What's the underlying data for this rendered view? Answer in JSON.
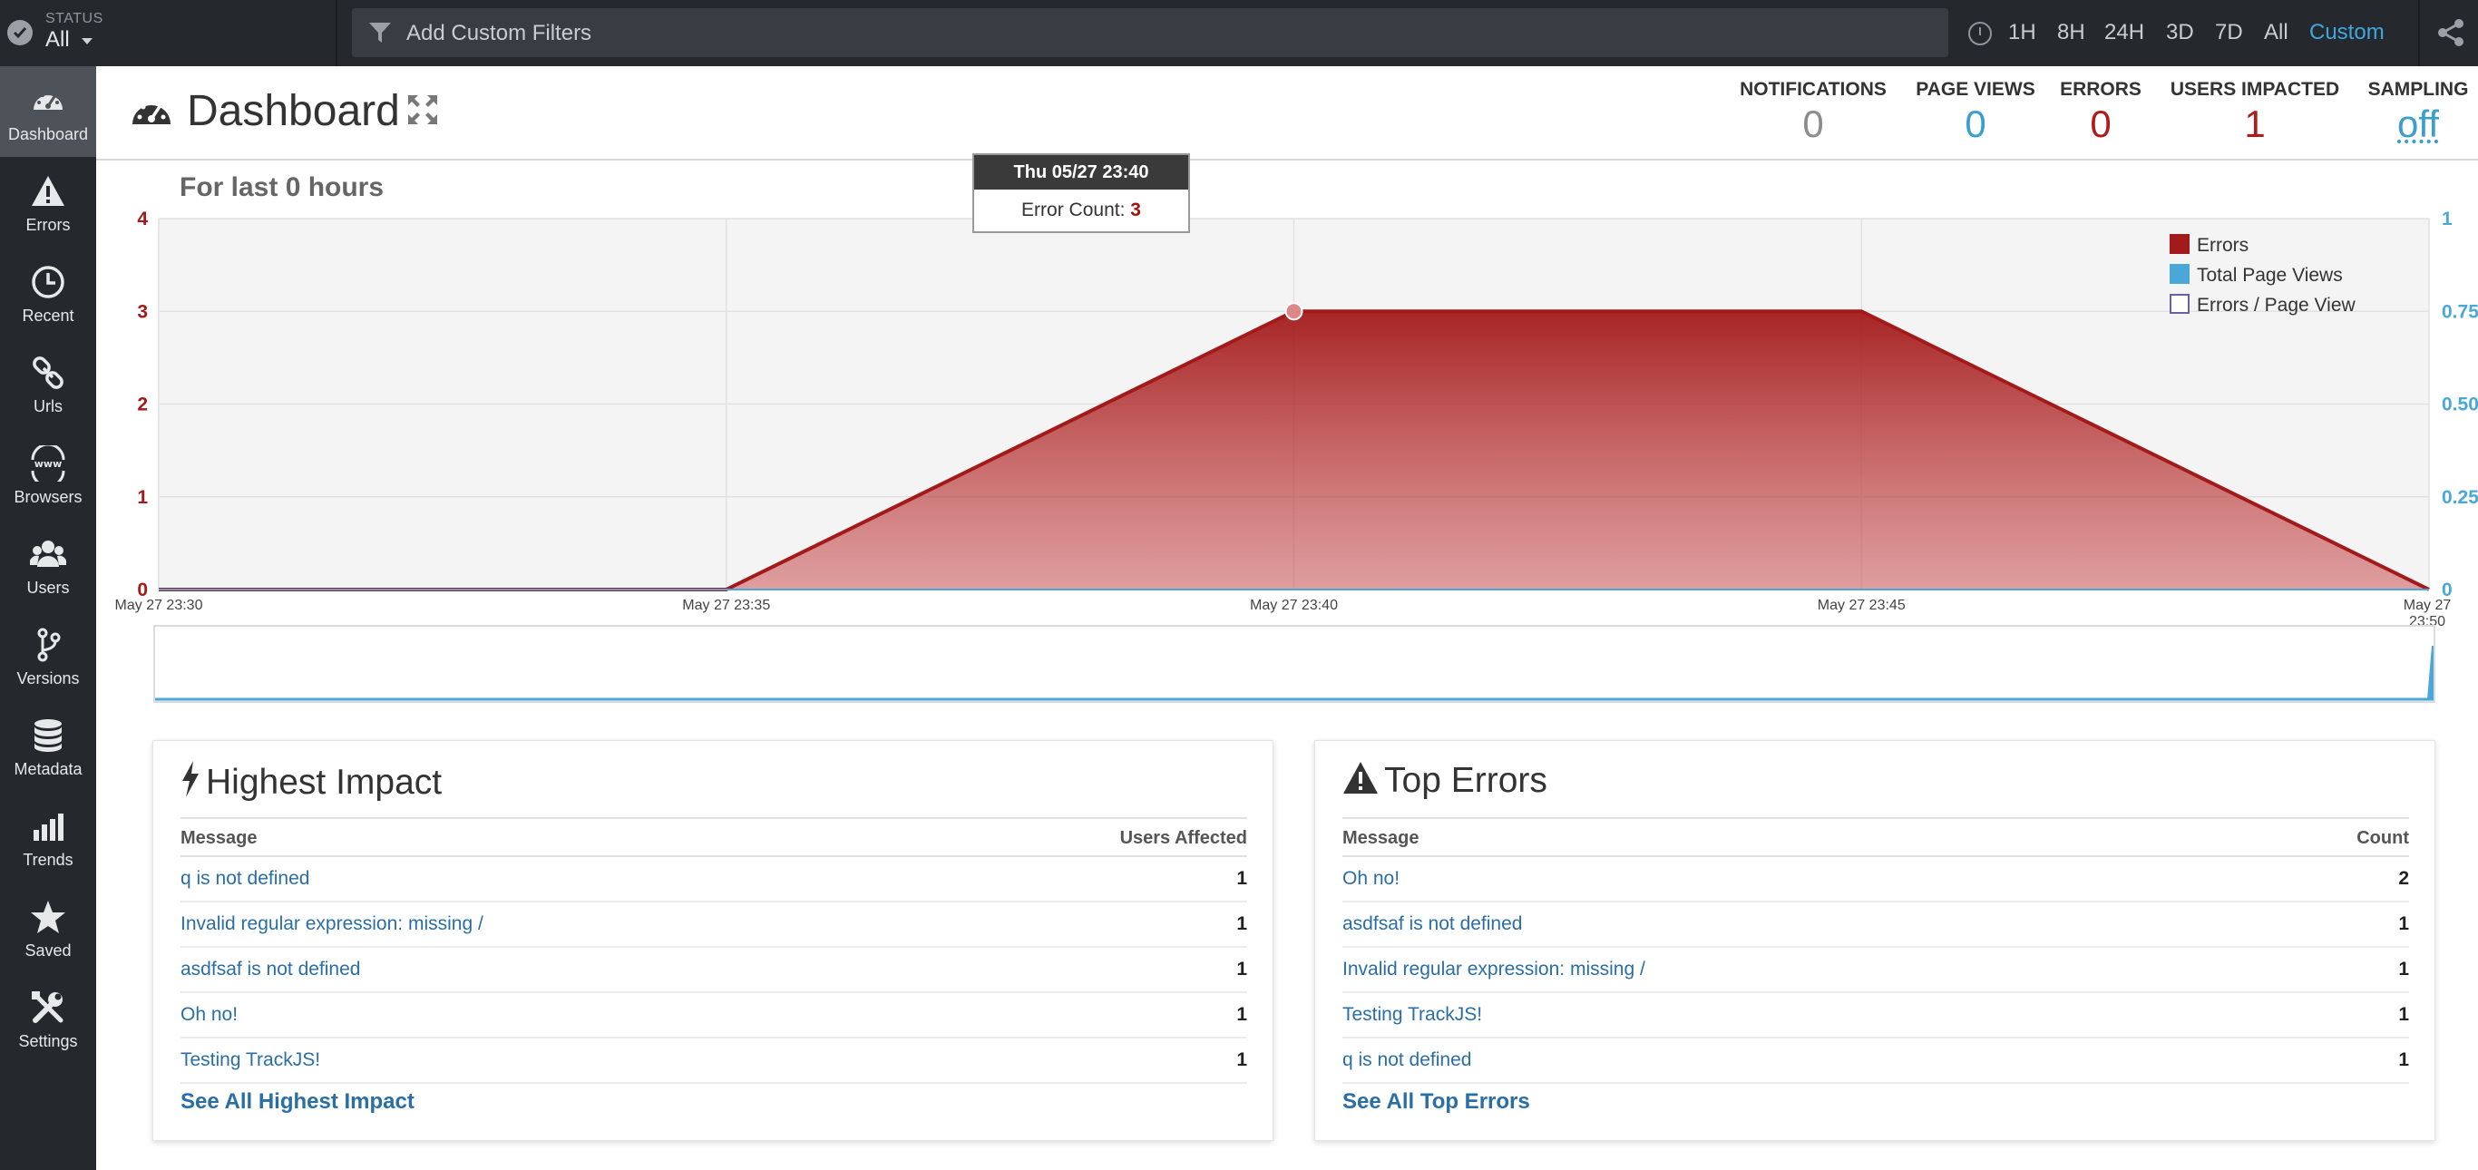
{
  "topbar": {
    "status_label": "STATUS",
    "status_value": "All",
    "filter_placeholder": "Add Custom Filters",
    "time_options": [
      "1H",
      "8H",
      "24H",
      "3D",
      "7D",
      "All",
      "Custom"
    ],
    "active_time_option": "Custom"
  },
  "nav": {
    "items": [
      {
        "label": "Dashboard",
        "icon": "dashboard-gauge-icon"
      },
      {
        "label": "Errors",
        "icon": "warning-triangle-icon"
      },
      {
        "label": "Recent",
        "icon": "clock-icon"
      },
      {
        "label": "Urls",
        "icon": "link-icon"
      },
      {
        "label": "Browsers",
        "icon": "www-globe-icon"
      },
      {
        "label": "Users",
        "icon": "users-icon"
      },
      {
        "label": "Versions",
        "icon": "branch-icon"
      },
      {
        "label": "Metadata",
        "icon": "database-icon"
      },
      {
        "label": "Trends",
        "icon": "bar-chart-icon"
      },
      {
        "label": "Saved",
        "icon": "star-icon"
      },
      {
        "label": "Settings",
        "icon": "wrench-icon"
      }
    ]
  },
  "header": {
    "title": "Dashboard",
    "stats": [
      {
        "label": "NOTIFICATIONS",
        "value": "0",
        "color": "#8c8c8c"
      },
      {
        "label": "PAGE VIEWS",
        "value": "0",
        "color": "#3a9fcf"
      },
      {
        "label": "ERRORS",
        "value": "0",
        "color": "#b01c1c"
      },
      {
        "label": "USERS IMPACTED",
        "value": "1",
        "color": "#b01c1c"
      },
      {
        "label": "SAMPLING",
        "value": "off",
        "color": "#3a9fcf"
      }
    ]
  },
  "chart_title": "For last 0 hours",
  "tooltip": {
    "header": "Thu 05/27 23:40",
    "label": "Error Count: ",
    "value": "3"
  },
  "chart_data": {
    "type": "area",
    "x": [
      "May 27 23:30",
      "May 27 23:35",
      "May 27 23:40",
      "May 27 23:45",
      "May 27 23:50"
    ],
    "xlabel": "",
    "ylabel": "",
    "series": [
      {
        "name": "Errors",
        "values": [
          0,
          0,
          3,
          3,
          0
        ],
        "color": "#a31a1a",
        "axis": "left"
      },
      {
        "name": "Total Page Views",
        "values": [
          0,
          0,
          0,
          0,
          0
        ],
        "color": "#4aa8d8",
        "axis": "right"
      },
      {
        "name": "Errors / Page View",
        "values": [],
        "color": "#6b5ea8",
        "axis": "right"
      }
    ],
    "ylim_left": [
      0,
      4
    ],
    "yticks_left": [
      "0",
      "1",
      "2",
      "3",
      "4"
    ],
    "ylim_right": [
      0,
      1
    ],
    "yticks_right": [
      "0",
      "0.25",
      "0.50",
      "0.75",
      "1"
    ],
    "legend_position": "top-right",
    "grid": true
  },
  "highest_impact": {
    "title": "Highest Impact",
    "col_message": "Message",
    "col_value": "Users Affected",
    "rows": [
      {
        "message": "q is not defined",
        "value": "1"
      },
      {
        "message": "Invalid regular expression: missing /",
        "value": "1"
      },
      {
        "message": "asdfsaf is not defined",
        "value": "1"
      },
      {
        "message": "Oh no!",
        "value": "1"
      },
      {
        "message": "Testing TrackJS!",
        "value": "1"
      }
    ],
    "see_all": "See All Highest Impact"
  },
  "top_errors": {
    "title": "Top Errors",
    "col_message": "Message",
    "col_value": "Count",
    "rows": [
      {
        "message": "Oh no!",
        "value": "2"
      },
      {
        "message": "asdfsaf is not defined",
        "value": "1"
      },
      {
        "message": "Invalid regular expression: missing /",
        "value": "1"
      },
      {
        "message": "Testing TrackJS!",
        "value": "1"
      },
      {
        "message": "q is not defined",
        "value": "1"
      }
    ],
    "see_all": "See All Top Errors"
  }
}
